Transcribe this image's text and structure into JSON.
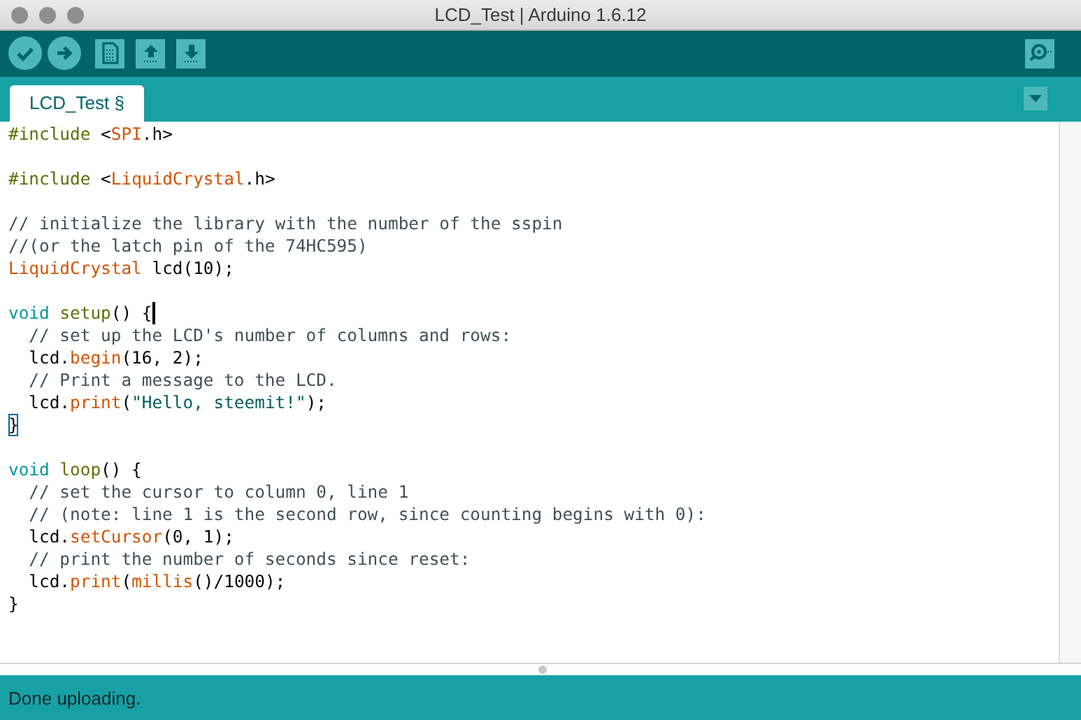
{
  "window": {
    "title": "LCD_Test | Arduino 1.6.12"
  },
  "toolbar": {
    "buttons": [
      {
        "kind": "verify"
      },
      {
        "kind": "upload"
      },
      {
        "kind": "new"
      },
      {
        "kind": "open"
      },
      {
        "kind": "save"
      }
    ],
    "serial_monitor": {
      "kind": "monitor"
    }
  },
  "tabs": [
    {
      "label": "LCD_Test §",
      "selected": true
    }
  ],
  "editor": {
    "lines": [
      {
        "kind": "code",
        "tokens": [
          {
            "text": "#include ",
            "kind": "preproc"
          },
          {
            "text": "<",
            "kind": "plain"
          },
          {
            "text": "SPI",
            "kind": "lib"
          },
          {
            "text": ".h>",
            "kind": "plain"
          }
        ]
      },
      {
        "kind": "blank"
      },
      {
        "kind": "code",
        "tokens": [
          {
            "text": "#include ",
            "kind": "preproc"
          },
          {
            "text": "<",
            "kind": "plain"
          },
          {
            "text": "LiquidCrystal",
            "kind": "lib"
          },
          {
            "text": ".h>",
            "kind": "plain"
          }
        ]
      },
      {
        "kind": "blank"
      },
      {
        "kind": "code",
        "tokens": [
          {
            "text": "// initialize the library with the number of the sspin",
            "kind": "comment"
          }
        ]
      },
      {
        "kind": "code",
        "tokens": [
          {
            "text": "//(or the latch pin of the 74HC595)",
            "kind": "comment"
          }
        ]
      },
      {
        "kind": "code",
        "tokens": [
          {
            "text": "LiquidCrystal",
            "kind": "lib"
          },
          {
            "text": " lcd(10);",
            "kind": "plain"
          }
        ]
      },
      {
        "kind": "blank"
      },
      {
        "kind": "code",
        "tokens": [
          {
            "text": "void ",
            "kind": "keyword"
          },
          {
            "text": "setup",
            "kind": "func"
          },
          {
            "text": "() ",
            "kind": "plain"
          },
          {
            "text": "{",
            "kind": "caret-brace"
          }
        ]
      },
      {
        "kind": "code",
        "tokens": [
          {
            "text": "  // set up the LCD's number of columns and rows:",
            "kind": "comment"
          }
        ]
      },
      {
        "kind": "code",
        "tokens": [
          {
            "text": "  lcd.",
            "kind": "plain"
          },
          {
            "text": "begin",
            "kind": "lib"
          },
          {
            "text": "(16, 2);",
            "kind": "plain"
          }
        ]
      },
      {
        "kind": "code",
        "tokens": [
          {
            "text": "  // Print a message to the LCD.",
            "kind": "comment"
          }
        ]
      },
      {
        "kind": "code",
        "tokens": [
          {
            "text": "  lcd.",
            "kind": "plain"
          },
          {
            "text": "print",
            "kind": "lib"
          },
          {
            "text": "(",
            "kind": "plain"
          },
          {
            "text": "\"Hello, steemit!\"",
            "kind": "string"
          },
          {
            "text": ");",
            "kind": "plain"
          }
        ]
      },
      {
        "kind": "code",
        "tokens": [
          {
            "text": "}",
            "kind": "match"
          }
        ]
      },
      {
        "kind": "blank"
      },
      {
        "kind": "code",
        "tokens": [
          {
            "text": "void ",
            "kind": "keyword"
          },
          {
            "text": "loop",
            "kind": "func"
          },
          {
            "text": "() {",
            "kind": "plain"
          }
        ]
      },
      {
        "kind": "code",
        "tokens": [
          {
            "text": "  // set the cursor to column 0, line 1",
            "kind": "comment"
          }
        ]
      },
      {
        "kind": "code",
        "tokens": [
          {
            "text": "  // (note: line 1 is the second row, since counting begins with 0):",
            "kind": "comment"
          }
        ]
      },
      {
        "kind": "code",
        "tokens": [
          {
            "text": "  lcd.",
            "kind": "plain"
          },
          {
            "text": "setCursor",
            "kind": "lib"
          },
          {
            "text": "(0, 1);",
            "kind": "plain"
          }
        ]
      },
      {
        "kind": "code",
        "tokens": [
          {
            "text": "  // print the number of seconds since reset:",
            "kind": "comment"
          }
        ]
      },
      {
        "kind": "code",
        "tokens": [
          {
            "text": "  lcd.",
            "kind": "plain"
          },
          {
            "text": "print",
            "kind": "lib"
          },
          {
            "text": "(",
            "kind": "plain"
          },
          {
            "text": "millis",
            "kind": "lib"
          },
          {
            "text": "()/1000);",
            "kind": "plain"
          }
        ]
      },
      {
        "kind": "code",
        "tokens": [
          {
            "text": "}",
            "kind": "plain"
          }
        ]
      }
    ]
  },
  "status_bar": {
    "message": "Done uploading."
  }
}
